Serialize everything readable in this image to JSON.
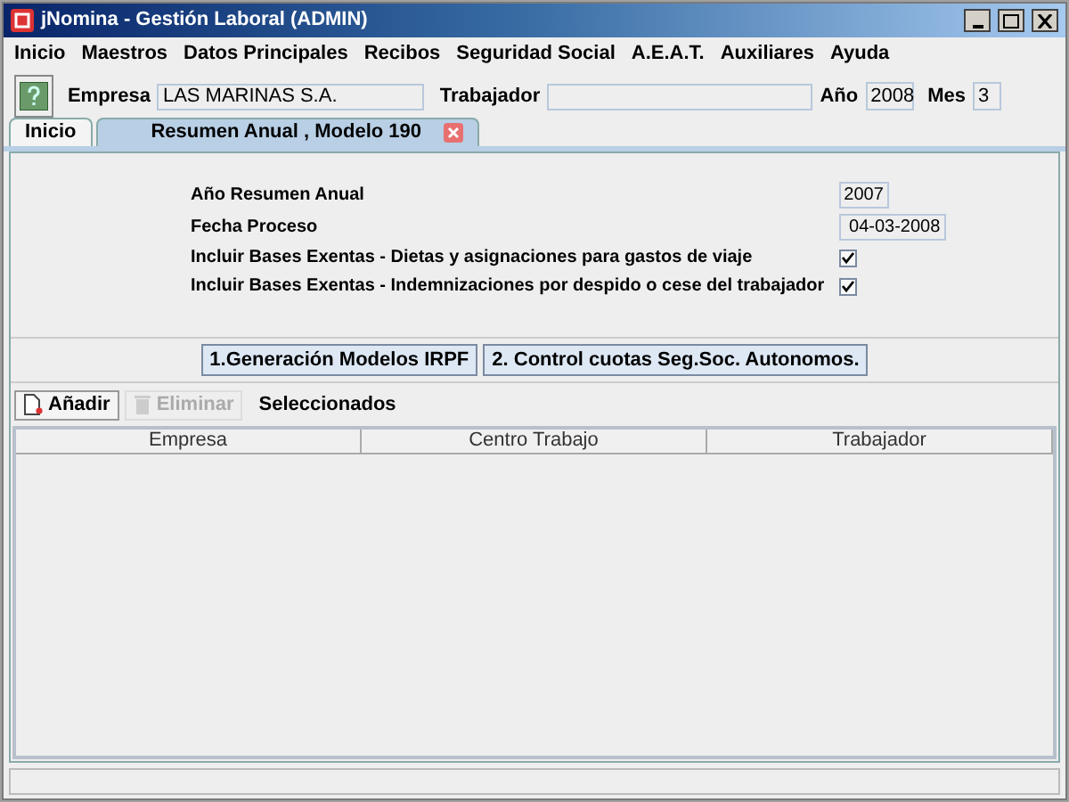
{
  "window": {
    "title": "jNomina - Gestión Laboral (ADMIN)"
  },
  "menu": [
    "Inicio",
    "Maestros",
    "Datos Principales",
    "Recibos",
    "Seguridad Social",
    "A.E.A.T.",
    "Auxiliares",
    "Ayuda"
  ],
  "header": {
    "empresa_label": "Empresa",
    "empresa": "LAS MARINAS S.A.",
    "trabajador_label": "Trabajador",
    "anio_label": "Año",
    "anio": "2008",
    "mes_label": "Mes",
    "mes": "3"
  },
  "tabs": [
    {
      "label": "Inicio",
      "selected": false,
      "closable": false
    },
    {
      "label": "Resumen Anual , Modelo 190",
      "selected": true,
      "closable": true
    }
  ],
  "form": {
    "anio_label": "Año Resumen Anual",
    "anio": "2007",
    "fecha_label": "Fecha Proceso",
    "fecha": "04-03-2008",
    "options": [
      {
        "label": "Incluir Bases Exentas - Dietas y asignaciones para gastos de viaje",
        "checked": true
      },
      {
        "label": "Incluir Bases Exentas - Indemnizaciones por despido o cese del trabajador",
        "checked": true
      }
    ]
  },
  "actions": [
    "1.Generación Modelos IRPF",
    "2. Control cuotas Seg.Soc. Autonomos."
  ],
  "toolbar": [
    {
      "label": "Añadir",
      "disabled": false
    },
    {
      "label": "Eliminar",
      "disabled": true
    }
  ],
  "selected_label": "Seleccionados",
  "table": {
    "columns": [
      "Empresa",
      "Centro Trabajo",
      "Trabajador"
    ]
  }
}
